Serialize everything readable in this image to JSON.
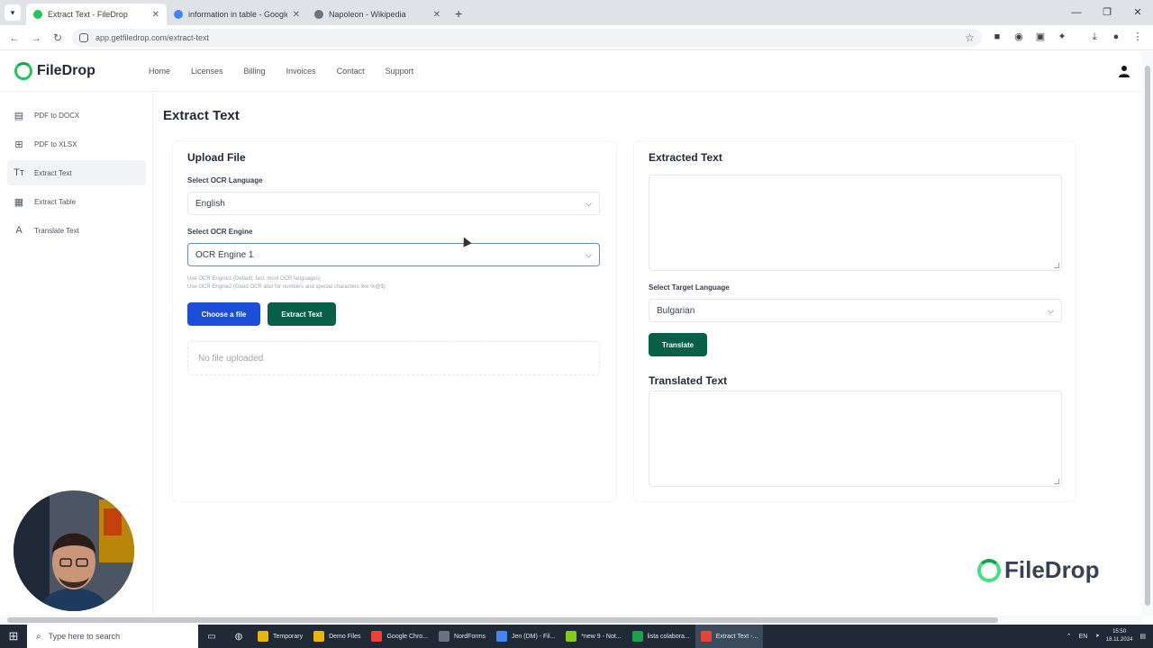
{
  "browser": {
    "tabs": [
      {
        "title": "Extract Text - FileDrop",
        "active": true,
        "favicon_color": "#22c55e"
      },
      {
        "title": "information in table - Google Se",
        "active": false,
        "favicon_color": "#4285f4"
      },
      {
        "title": "Napoleon - Wikipedia",
        "active": false,
        "favicon_color": "#6b7280"
      }
    ],
    "url": "app.getfiledrop.com/extract-text",
    "newtab": "+",
    "min": "—",
    "restore": "❐",
    "close": "✕"
  },
  "app": {
    "brand": "FileDrop",
    "nav": [
      "Home",
      "Licenses",
      "Billing",
      "Invoices",
      "Contact",
      "Support"
    ],
    "sidebar": [
      {
        "label": "PDF to DOCX",
        "icon": "docx-icon",
        "glyph": "▤",
        "active": false
      },
      {
        "label": "PDF to XLSX",
        "icon": "xlsx-icon",
        "glyph": "⊞",
        "active": false
      },
      {
        "label": "Extract Text",
        "icon": "text-icon",
        "glyph": "Tт",
        "active": true
      },
      {
        "label": "Extract Table",
        "icon": "table-icon",
        "glyph": "▦",
        "active": false
      },
      {
        "label": "Translate Text",
        "icon": "translate-icon",
        "glyph": "A",
        "active": false
      }
    ],
    "page_title": "Extract Text",
    "upload": {
      "heading": "Upload File",
      "ocr_language_label": "Select OCR Language",
      "ocr_language_value": "English",
      "ocr_engine_label": "Select OCR Engine",
      "ocr_engine_value": "OCR Engine 1",
      "hint_line1": "Use OCR Engine1 (Default, fast, most OCR languages)",
      "hint_line2": "Use OCR Engine2 (Good OCR also for numbers and special characters like %@$)",
      "choose_button": "Choose a file",
      "extract_button": "Extract Text",
      "dropzone_text": "No file uploaded"
    },
    "result": {
      "extracted_heading": "Extracted Text",
      "target_language_label": "Select Target Language",
      "target_language_value": "Bulgarian",
      "translate_button": "Translate",
      "translated_heading": "Translated Text"
    },
    "colors": {
      "primary_blue": "#1d4ed8",
      "primary_green": "#065f46",
      "brand_green": "#22c55e"
    }
  },
  "taskbar": {
    "search_placeholder": "Type here to search",
    "apps": [
      {
        "label": "Temporary",
        "color": "#eab308"
      },
      {
        "label": "Demo Files",
        "color": "#eab308"
      },
      {
        "label": "Google Chro...",
        "color": "#ea4335"
      },
      {
        "label": "NordForms",
        "color": "#6b7280"
      },
      {
        "label": "Jen (DM) - Fil...",
        "color": "#4285f4"
      },
      {
        "label": "*new 9 - Not...",
        "color": "#84cc16"
      },
      {
        "label": "lista colabora...",
        "color": "#16a34a"
      },
      {
        "label": "Extract Text -...",
        "color": "#ea4335"
      }
    ],
    "lang": "EN",
    "time": "15:50",
    "date": "18.11.2024"
  }
}
